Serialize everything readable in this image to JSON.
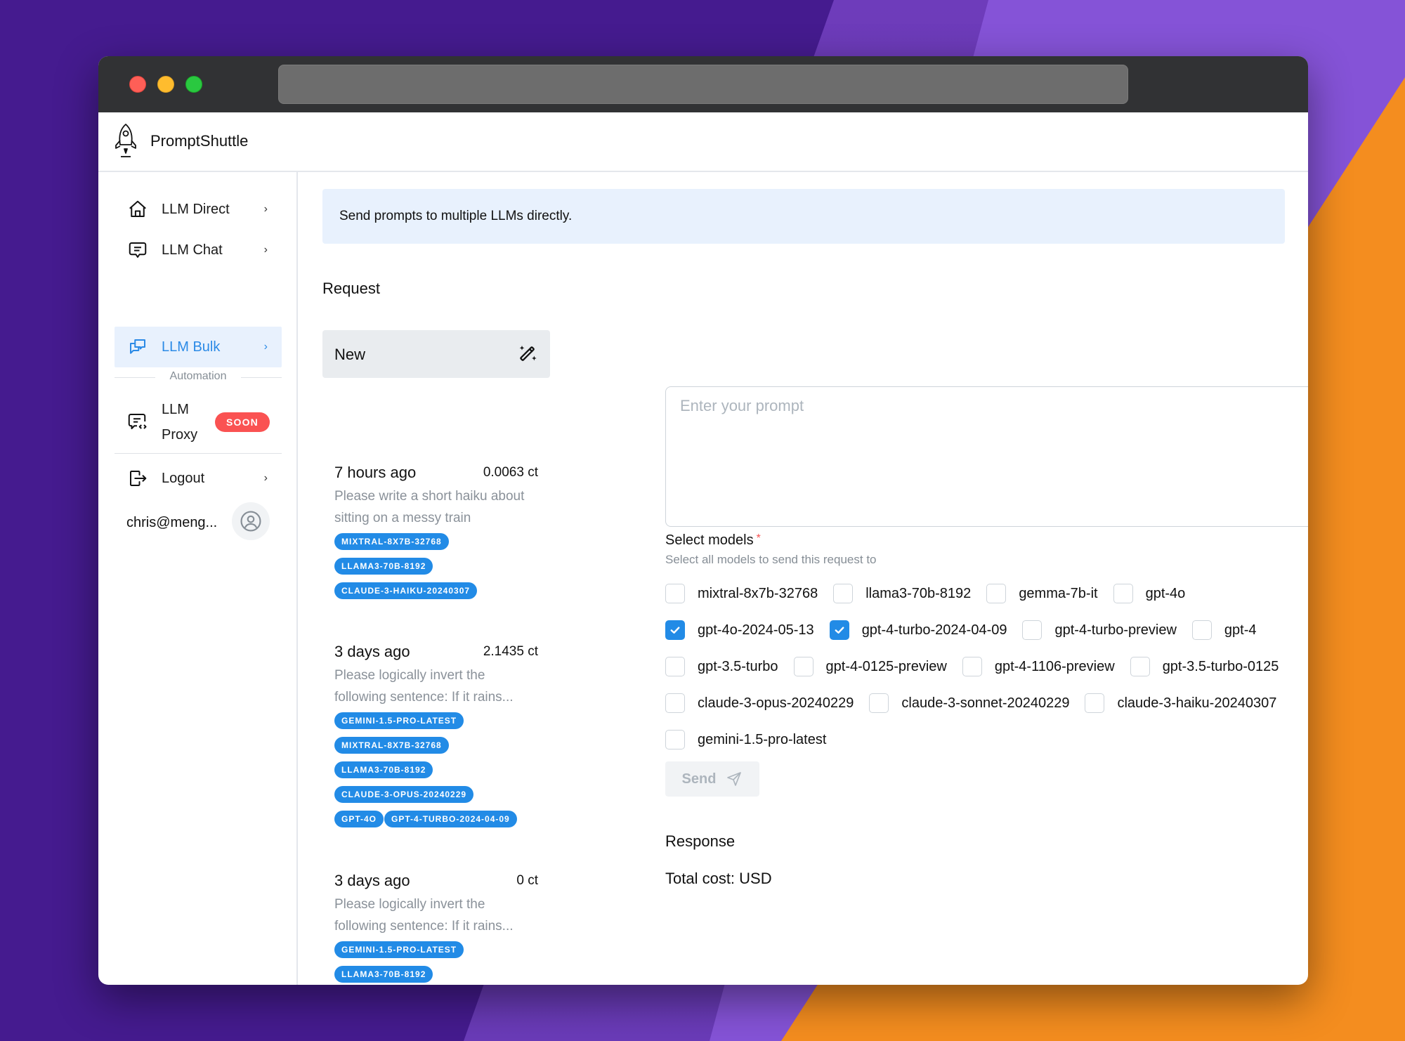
{
  "app": {
    "title": "PromptShuttle"
  },
  "sidebar": {
    "items": [
      {
        "label": "LLM Direct",
        "icon": "home-icon",
        "active": false
      },
      {
        "label": "LLM Chat",
        "icon": "chat-icon",
        "active": false
      },
      {
        "label": "LLM Bulk",
        "icon": "messages-icon",
        "active": true
      }
    ],
    "section_label": "Automation",
    "proxy": {
      "label": "LLM Proxy",
      "badge": "SOON",
      "icon": "code-chat-icon"
    },
    "logout": {
      "label": "Logout",
      "icon": "logout-icon"
    },
    "user": {
      "email": "chris@meng...",
      "icon": "user-circle-icon"
    },
    "chevron": "›"
  },
  "main": {
    "banner": "Send prompts to multiple LLMs directly.",
    "request_heading": "Request",
    "new_label": "New",
    "history": [
      {
        "when": "7 hours ago",
        "cost": "0.0063 ct",
        "prompt": "Please write a short haiku about sitting on a messy train",
        "tags": [
          "MIXTRAL-8X7B-32768",
          "LLAMA3-70B-8192",
          "CLAUDE-3-HAIKU-20240307"
        ]
      },
      {
        "when": "3 days ago",
        "cost": "2.1435 ct",
        "prompt": "Please logically invert the following sentence: If it rains...",
        "tags": [
          "GEMINI-1.5-PRO-LATEST",
          "MIXTRAL-8X7B-32768",
          "LLAMA3-70B-8192",
          "CLAUDE-3-OPUS-20240229",
          "GPT-4O",
          "GPT-4-TURBO-2024-04-09"
        ]
      },
      {
        "when": "3 days ago",
        "cost": "0 ct",
        "prompt": "Please logically invert the following sentence: If it rains...",
        "tags": [
          "GEMINI-1.5-PRO-LATEST",
          "LLAMA3-70B-8192"
        ]
      }
    ],
    "prompt": {
      "value": "",
      "placeholder": "Enter your prompt"
    },
    "select_models": {
      "label": "Select models",
      "required_mark": "*",
      "description": "Select all models to send this request to",
      "rows": [
        [
          {
            "name": "mixtral-8x7b-32768",
            "checked": false
          },
          {
            "name": "llama3-70b-8192",
            "checked": false
          },
          {
            "name": "gemma-7b-it",
            "checked": false
          },
          {
            "name": "gpt-4o",
            "checked": false
          }
        ],
        [
          {
            "name": "gpt-4o-2024-05-13",
            "checked": true
          },
          {
            "name": "gpt-4-turbo-2024-04-09",
            "checked": true
          },
          {
            "name": "gpt-4-turbo-preview",
            "checked": false
          },
          {
            "name": "gpt-4",
            "checked": false
          }
        ],
        [
          {
            "name": "gpt-3.5-turbo",
            "checked": false
          },
          {
            "name": "gpt-4-0125-preview",
            "checked": false
          },
          {
            "name": "gpt-4-1106-preview",
            "checked": false
          },
          {
            "name": "gpt-3.5-turbo-0125",
            "checked": false
          }
        ],
        [
          {
            "name": "claude-3-opus-20240229",
            "checked": false
          },
          {
            "name": "claude-3-sonnet-20240229",
            "checked": false
          },
          {
            "name": "claude-3-haiku-20240307",
            "checked": false
          }
        ],
        [
          {
            "name": "gemini-1.5-pro-latest",
            "checked": false
          }
        ]
      ]
    },
    "send_label": "Send",
    "response_heading": "Response",
    "total_cost": "Total cost: USD"
  },
  "colors": {
    "accent": "#228be6",
    "active_bg": "#e8f1fd",
    "badge_red": "#fa5252"
  }
}
